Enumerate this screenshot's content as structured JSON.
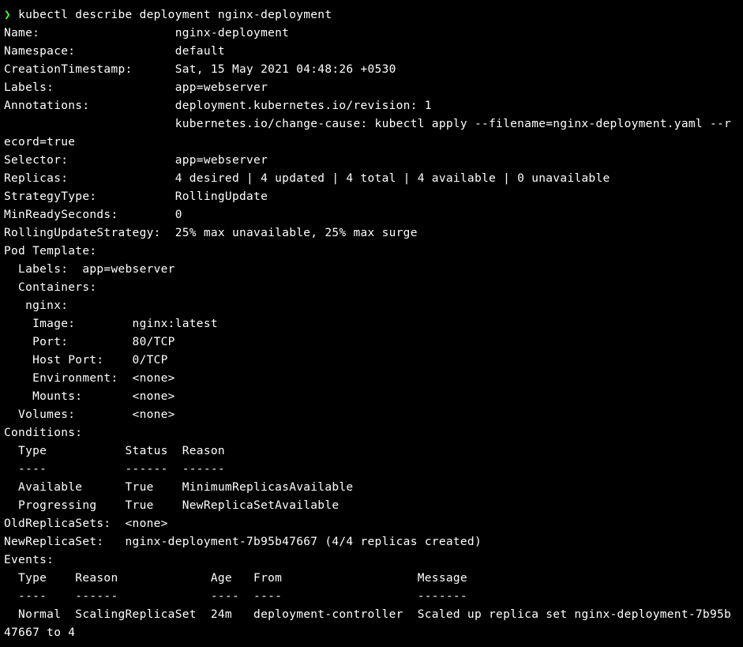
{
  "prompt": {
    "symbol": "❯",
    "command": "kubectl describe deployment nginx-deployment"
  },
  "output": {
    "text": "Name:                   nginx-deployment\nNamespace:              default\nCreationTimestamp:      Sat, 15 May 2021 04:48:26 +0530\nLabels:                 app=webserver\nAnnotations:            deployment.kubernetes.io/revision: 1\n                        kubernetes.io/change-cause: kubectl apply --filename=nginx-deployment.yaml --r\necord=true\nSelector:               app=webserver\nReplicas:               4 desired | 4 updated | 4 total | 4 available | 0 unavailable\nStrategyType:           RollingUpdate\nMinReadySeconds:        0\nRollingUpdateStrategy:  25% max unavailable, 25% max surge\nPod Template:\n  Labels:  app=webserver\n  Containers:\n   nginx:\n    Image:        nginx:latest\n    Port:         80/TCP\n    Host Port:    0/TCP\n    Environment:  <none>\n    Mounts:       <none>\n  Volumes:        <none>\nConditions:\n  Type           Status  Reason\n  ----           ------  ------\n  Available      True    MinimumReplicasAvailable\n  Progressing    True    NewReplicaSetAvailable\nOldReplicaSets:  <none>\nNewReplicaSet:   nginx-deployment-7b95b47667 (4/4 replicas created)\nEvents:\n  Type    Reason             Age   From                   Message\n  ----    ------             ----  ----                   -------\n  Normal  ScalingReplicaSet  24m   deployment-controller  Scaled up replica set nginx-deployment-7b95b\n47667 to 4"
  },
  "deployment": {
    "name": "nginx-deployment",
    "namespace": "default",
    "creationTimestamp": "Sat, 15 May 2021 04:48:26 +0530",
    "labels": "app=webserver",
    "annotations": {
      "revision": "deployment.kubernetes.io/revision: 1",
      "changeCause": "kubernetes.io/change-cause: kubectl apply --filename=nginx-deployment.yaml --record=true"
    },
    "selector": "app=webserver",
    "replicas": {
      "desired": 4,
      "updated": 4,
      "total": 4,
      "available": 4,
      "unavailable": 0
    },
    "strategyType": "RollingUpdate",
    "minReadySeconds": 0,
    "rollingUpdateStrategy": "25% max unavailable, 25% max surge",
    "podTemplate": {
      "labels": "app=webserver",
      "containers": {
        "nginx": {
          "image": "nginx:latest",
          "port": "80/TCP",
          "hostPort": "0/TCP",
          "environment": "<none>",
          "mounts": "<none>"
        }
      },
      "volumes": "<none>"
    },
    "conditions": [
      {
        "type": "Available",
        "status": "True",
        "reason": "MinimumReplicasAvailable"
      },
      {
        "type": "Progressing",
        "status": "True",
        "reason": "NewReplicaSetAvailable"
      }
    ],
    "oldReplicaSets": "<none>",
    "newReplicaSet": "nginx-deployment-7b95b47667 (4/4 replicas created)",
    "events": [
      {
        "type": "Normal",
        "reason": "ScalingReplicaSet",
        "age": "24m",
        "from": "deployment-controller",
        "message": "Scaled up replica set nginx-deployment-7b95b47667 to 4"
      }
    ]
  }
}
